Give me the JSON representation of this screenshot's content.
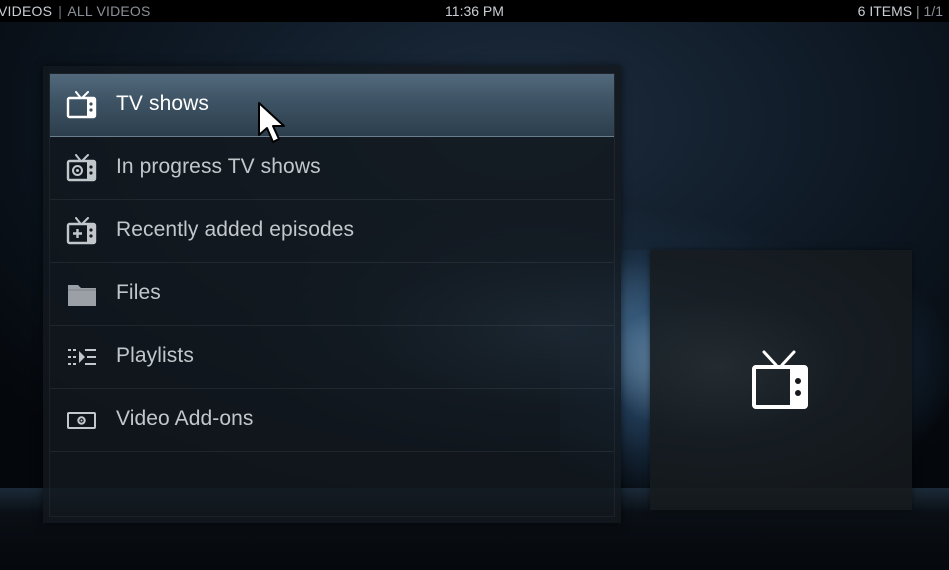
{
  "topbar": {
    "section": "VIDEOS",
    "separator": "|",
    "subsection": "ALL VIDEOS",
    "clock": "11:36 PM",
    "item_count": "6 ITEMS",
    "page_separator": "|",
    "page": "1/1"
  },
  "menu": {
    "items": [
      {
        "label": "TV shows",
        "icon": "tv-icon",
        "focused": true
      },
      {
        "label": "In progress TV shows",
        "icon": "tv-in-progress-icon",
        "focused": false
      },
      {
        "label": "Recently added episodes",
        "icon": "tv-add-icon",
        "focused": false
      },
      {
        "label": "Files",
        "icon": "folder-icon",
        "focused": false
      },
      {
        "label": "Playlists",
        "icon": "playlist-icon",
        "focused": false
      },
      {
        "label": "Video Add-ons",
        "icon": "addon-icon",
        "focused": false
      }
    ]
  },
  "preview": {
    "icon": "tv-icon"
  },
  "colors": {
    "focus_highlight": "#3d5364",
    "text_normal": "#c2c7cc",
    "text_focused": "#ffffff",
    "topbar_bg": "#000000"
  }
}
